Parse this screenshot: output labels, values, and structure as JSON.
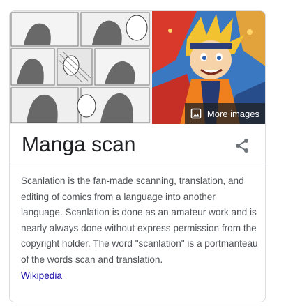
{
  "knowledge_panel": {
    "images": [
      {
        "alt": "Manga scan page with black and white panels",
        "icon": "manga-page-image"
      },
      {
        "alt": "Colorful anime character illustration",
        "icon": "anime-character-image"
      }
    ],
    "more_images_label": "More images",
    "more_images_icon": "image-icon",
    "title": "Manga scan",
    "share_icon": "share-icon",
    "description": "Scanlation is the fan-made scanning, translation, and editing of comics from a language into another language. Scanlation is done as an amateur work and is nearly always done without express permission from the copyright holder. The word \"scanlation\" is a portmanteau of the words scan and translation.",
    "source_link": "Wikipedia"
  },
  "colors": {
    "title_text": "#202124",
    "body_text": "#4d5156",
    "link": "#1a0dab",
    "border": "#dadce0",
    "overlay": "#202124"
  }
}
